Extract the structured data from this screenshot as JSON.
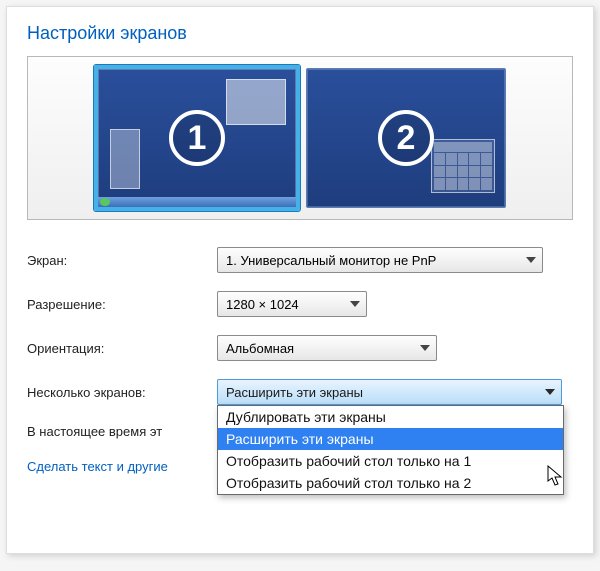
{
  "title": "Настройки экранов",
  "monitors": {
    "primary_number": "1",
    "secondary_number": "2"
  },
  "labels": {
    "display": "Экран:",
    "resolution": "Разрешение:",
    "orientation": "Ориентация:",
    "multi": "Несколько экранов:",
    "status_prefix": "В настоящее время эт",
    "link_prefix": "Сделать текст и другие"
  },
  "values": {
    "display": "1. Универсальный монитор не PnP",
    "resolution": "1280 × 1024",
    "orientation": "Альбомная",
    "multi": "Расширить эти экраны"
  },
  "multi_options": [
    "Дублировать эти экраны",
    "Расширить эти экраны",
    "Отобразить рабочий стол только на 1",
    "Отобразить рабочий стол только на 2"
  ],
  "multi_selected_index": 1
}
